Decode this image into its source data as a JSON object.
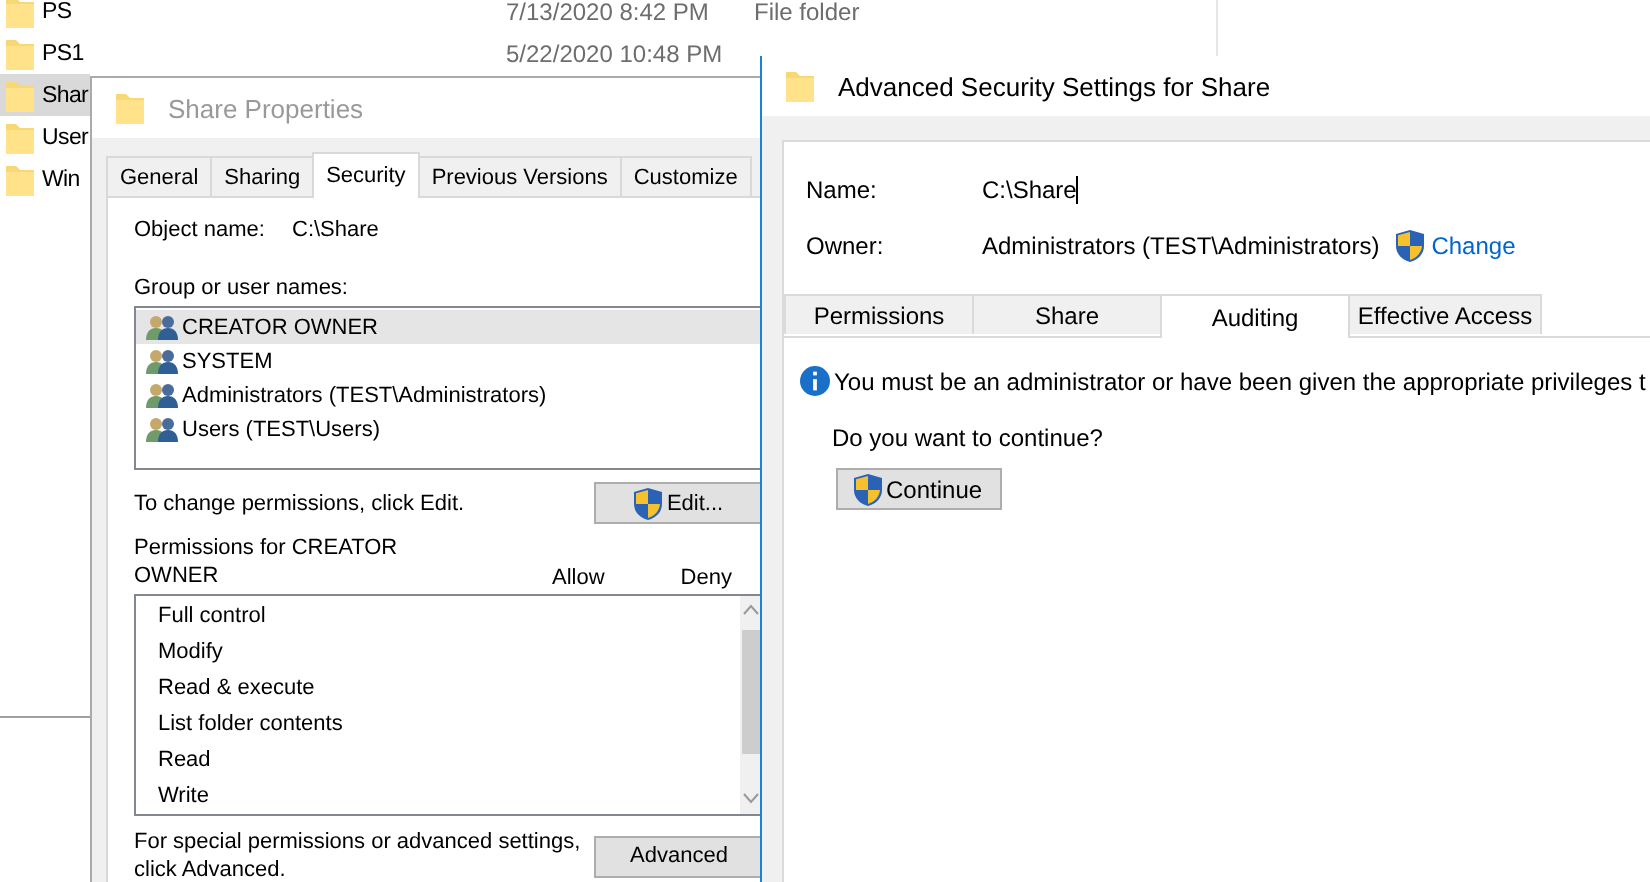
{
  "explorer": {
    "rows": [
      {
        "name": "PS",
        "date": "7/13/2020 8:42 PM",
        "type": "File folder",
        "selected": false
      },
      {
        "name": "PS1",
        "date": "5/22/2020 10:48 PM",
        "selected": false
      },
      {
        "name": "Shar",
        "selected": true
      },
      {
        "name": "User",
        "selected": false
      },
      {
        "name": "Win",
        "selected": false
      }
    ]
  },
  "properties_window": {
    "title": "Share Properties",
    "tabs": [
      {
        "label": "General",
        "selected": false
      },
      {
        "label": "Sharing",
        "selected": false
      },
      {
        "label": "Security",
        "selected": true
      },
      {
        "label": "Previous Versions",
        "selected": false
      },
      {
        "label": "Customize",
        "selected": false
      }
    ],
    "object_name_label": "Object name:",
    "object_name": "C:\\Share",
    "groups_label": "Group or user names:",
    "groups": [
      {
        "name": "CREATOR OWNER",
        "selected": true
      },
      {
        "name": "SYSTEM",
        "selected": false
      },
      {
        "name": "Administrators (TEST\\Administrators)",
        "selected": false
      },
      {
        "name": "Users (TEST\\Users)",
        "selected": false
      }
    ],
    "edit_hint": "To change permissions, click Edit.",
    "edit_button": "Edit...",
    "permissions_label": "Permissions for CREATOR OWNER",
    "allow_label": "Allow",
    "deny_label": "Deny",
    "permissions": [
      "Full control",
      "Modify",
      "Read & execute",
      "List folder contents",
      "Read",
      "Write"
    ],
    "advanced_hint": "For special permissions or advanced settings, click Advanced.",
    "advanced_button": "Advanced"
  },
  "advanced_window": {
    "title": "Advanced Security Settings for Share",
    "name_label": "Name:",
    "name": "C:\\Share",
    "owner_label": "Owner:",
    "owner": "Administrators (TEST\\Administrators)",
    "change_link": "Change",
    "tabs": [
      {
        "label": "Permissions",
        "selected": false
      },
      {
        "label": "Share",
        "selected": false
      },
      {
        "label": "Auditing",
        "selected": true
      },
      {
        "label": "Effective Access",
        "selected": false
      }
    ],
    "info": "You must be an administrator or have been given the appropriate privileges t",
    "question": "Do you want to continue?",
    "continue_button": "Continue"
  }
}
